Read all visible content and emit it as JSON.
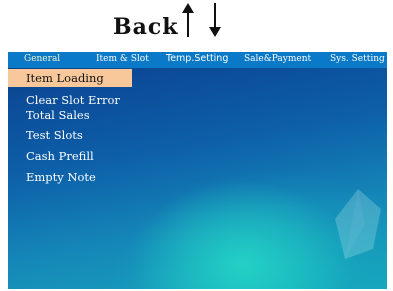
{
  "header": {
    "back_label": "Back"
  },
  "tabs": [
    {
      "label": "General",
      "selected": true
    },
    {
      "label": "Item & Slot",
      "selected": false
    },
    {
      "label": "Temp.Setting",
      "selected": false
    },
    {
      "label": "Sale&Payment",
      "selected": false
    },
    {
      "label": "Sys. Setting",
      "selected": false
    }
  ],
  "menu": [
    {
      "label": "Item Loading",
      "selected": true
    },
    {
      "label": "Clear Slot Error",
      "selected": false
    },
    {
      "label": "Total Sales",
      "selected": false
    },
    {
      "label": "Test Slots",
      "selected": false
    },
    {
      "label": "Cash Prefill",
      "selected": false
    },
    {
      "label": "Empty Note",
      "selected": false
    }
  ],
  "colors": {
    "tabbar": "#0a79c8",
    "selection": "#f8c89a",
    "background_top": "#0b3f8c",
    "background_glow": "#28e1c8"
  },
  "icons": {
    "up": "arrow-up-icon",
    "down": "arrow-down-icon"
  }
}
